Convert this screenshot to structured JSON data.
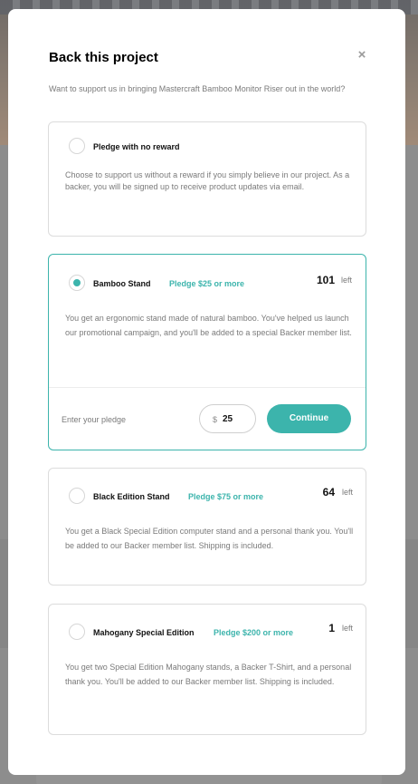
{
  "modal": {
    "title": "Back this project",
    "close_glyph": "×",
    "intro": "Want to support us in bringing Mastercraft Bamboo Monitor Riser out in the world?"
  },
  "rewards": [
    {
      "name": "Pledge with no reward",
      "pledge": "",
      "left": "",
      "left_label": "",
      "description": "Choose to support us without a reward if you simply believe in our project. As a backer, you will be signed up to receive product updates via email.",
      "selected": false
    },
    {
      "name": "Bamboo Stand",
      "pledge": "Pledge $25 or more",
      "left": "101",
      "left_label": "left",
      "description": "You get an ergonomic stand made of natural bamboo. You've helped us launch our promotional campaign, and you'll be added to a special Backer member list.",
      "selected": true
    },
    {
      "name": "Black Edition Stand",
      "pledge": "Pledge $75 or more",
      "left": "64",
      "left_label": "left",
      "description": "You get a Black Special Edition computer stand and a personal thank you. You'll be added to our Backer member list. Shipping is included.",
      "selected": false
    },
    {
      "name": "Mahogany Special Edition",
      "pledge": "Pledge $200 or more",
      "left": "1",
      "left_label": "left",
      "description": "You get two Special Edition Mahogany stands, a Backer T-Shirt, and a personal thank you. You'll be added to our Backer member list. Shipping is included.",
      "selected": false
    }
  ],
  "pledge_form": {
    "label": "Enter your pledge",
    "currency": "$",
    "amount": "25",
    "button": "Continue"
  },
  "colors": {
    "accent": "#3cb4ac",
    "overlay": "#7b7b7b"
  }
}
